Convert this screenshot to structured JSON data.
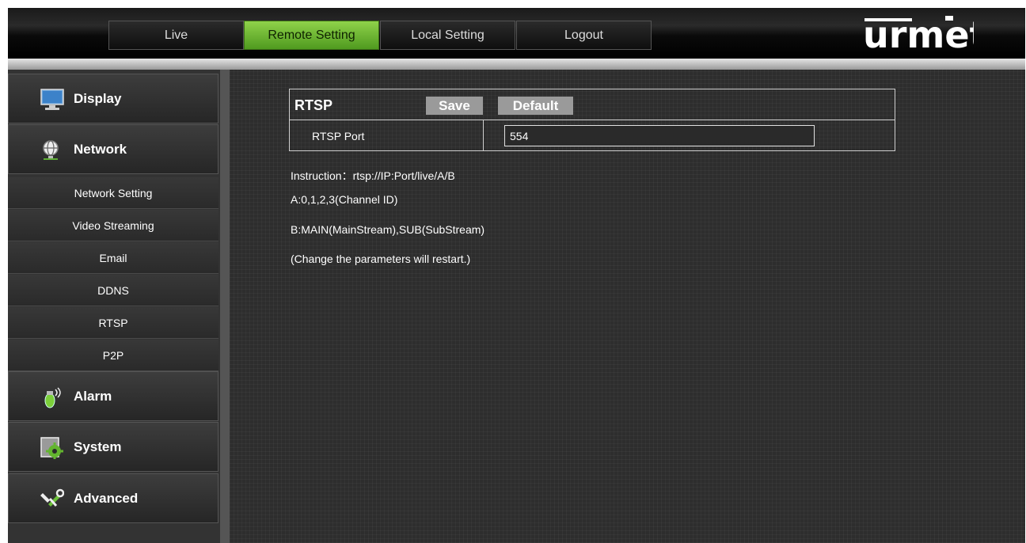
{
  "nav": {
    "live": "Live",
    "remote_setting": "Remote Setting",
    "local_setting": "Local Setting",
    "logout": "Logout",
    "active": "Remote Setting"
  },
  "logo": {
    "text": "urmet"
  },
  "sidebar": {
    "categories": [
      {
        "label": "Display",
        "icon": "monitor-icon"
      },
      {
        "label": "Network",
        "icon": "globe-icon"
      },
      {
        "label": "Alarm",
        "icon": "alarm-icon"
      },
      {
        "label": "System",
        "icon": "system-gear-icon"
      },
      {
        "label": "Advanced",
        "icon": "wrench-icon"
      }
    ],
    "network_items": [
      "Network Setting",
      "Video Streaming",
      "Email",
      "DDNS",
      "RTSP",
      "P2P"
    ]
  },
  "panel": {
    "title": "RTSP",
    "save_label": "Save",
    "default_label": "Default",
    "port_label": "RTSP Port",
    "port_value": "554"
  },
  "info": {
    "instruction": "Instruction：rtsp://IP:Port/live/A/B",
    "line_a": "A:0,1,2,3(Channel ID)",
    "line_b": "B:MAIN(MainStream),SUB(SubStream)",
    "note": "(Change the parameters will restart.)"
  },
  "colors": {
    "active_tab": "#6cb52e",
    "background": "#2d2d2d",
    "sidebar": "#333333"
  }
}
